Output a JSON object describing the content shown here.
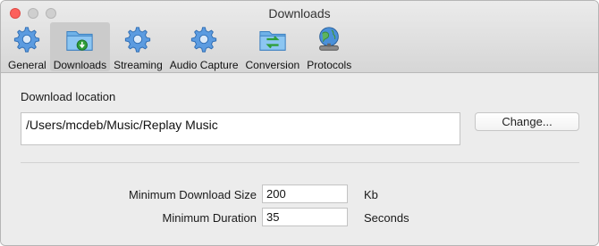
{
  "window": {
    "title": "Downloads"
  },
  "tabs": [
    {
      "label": "General",
      "icon": "gear-icon"
    },
    {
      "label": "Downloads",
      "icon": "download-folder-icon",
      "active": true
    },
    {
      "label": "Streaming",
      "icon": "gear-icon"
    },
    {
      "label": "Audio Capture",
      "icon": "gear-icon"
    },
    {
      "label": "Conversion",
      "icon": "conversion-folder-icon"
    },
    {
      "label": "Protocols",
      "icon": "globe-network-icon"
    }
  ],
  "download_location": {
    "label": "Download location",
    "path": "/Users/mcdeb/Music/Replay Music",
    "change_button": "Change..."
  },
  "min_download_size": {
    "label": "Minimum Download Size",
    "value": "200",
    "unit": "Kb"
  },
  "min_duration": {
    "label": "Minimum Duration",
    "value": "35",
    "unit": "Seconds"
  },
  "colors": {
    "close": "#fc605c",
    "icon_blue": "#4a90d9",
    "icon_green": "#2e9e3a"
  }
}
